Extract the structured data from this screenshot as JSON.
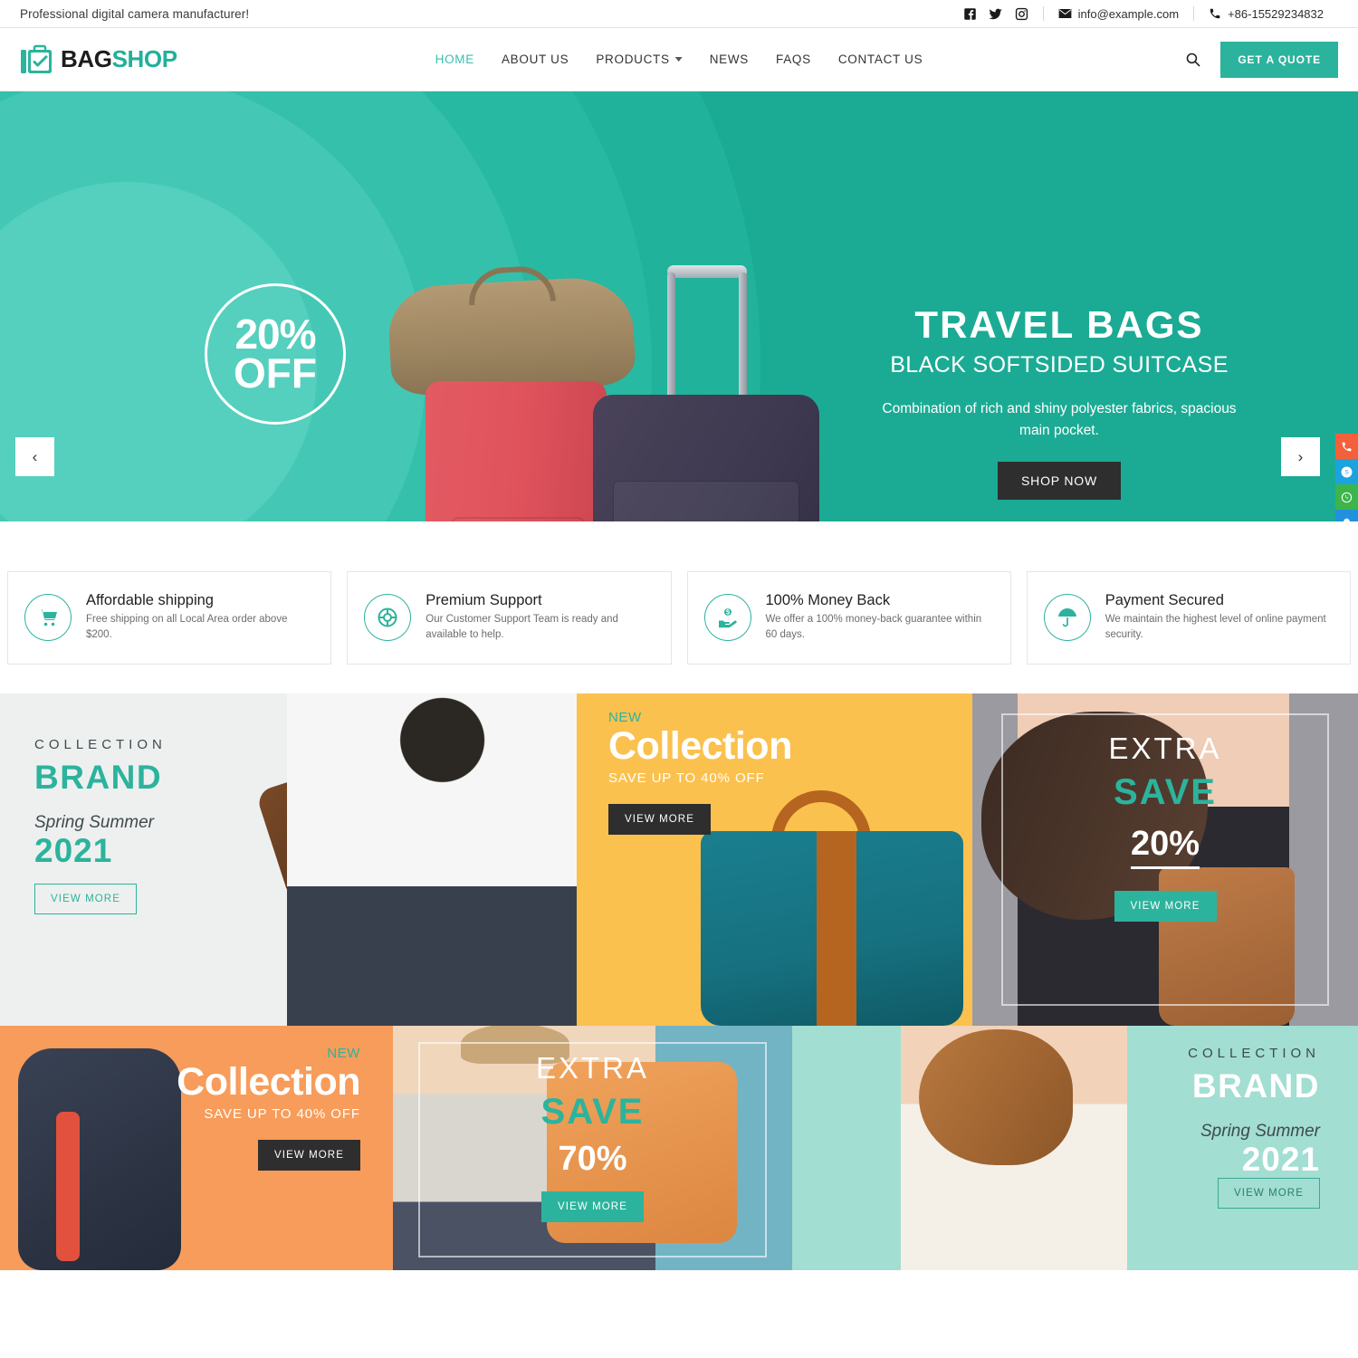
{
  "topbar": {
    "tagline": "Professional digital camera manufacturer!",
    "social": [
      {
        "name": "facebook-icon",
        "label": "Facebook"
      },
      {
        "name": "twitter-icon",
        "label": "Twitter"
      },
      {
        "name": "instagram-icon",
        "label": "Instagram"
      }
    ],
    "email": "info@example.com",
    "phone": "+86-15529234832"
  },
  "header": {
    "logo": {
      "part1": "BAG",
      "part2": "SHOP"
    },
    "nav": [
      {
        "label": "HOME",
        "active": true,
        "dropdown": false
      },
      {
        "label": "ABOUT US",
        "active": false,
        "dropdown": false
      },
      {
        "label": "PRODUCTS",
        "active": false,
        "dropdown": true
      },
      {
        "label": "NEWS",
        "active": false,
        "dropdown": false
      },
      {
        "label": "FAQS",
        "active": false,
        "dropdown": false
      },
      {
        "label": "CONTACT US",
        "active": false,
        "dropdown": false
      }
    ],
    "search_label": "Search",
    "quote_button": "GET A QUOTE"
  },
  "hero": {
    "badge_line1": "20%",
    "badge_line2": "OFF",
    "title": "TRAVEL BAGS",
    "subtitle": "BLACK SOFTSIDED SUITCASE",
    "description": "Combination of rich and shiny polyester fabrics, spacious main pocket.",
    "cta": "SHOP NOW",
    "prev_arrow": "‹",
    "next_arrow": "›",
    "background_color": "#1bab94"
  },
  "contact_rail": [
    {
      "name": "phone-icon",
      "color": "#f2603c"
    },
    {
      "name": "skype-icon",
      "color": "#1ba3e0"
    },
    {
      "name": "whatsapp-icon",
      "color": "#3cb54a"
    },
    {
      "name": "qq-icon",
      "color": "#2291dd"
    },
    {
      "name": "wechat-icon",
      "color": "#3cb54a"
    },
    {
      "name": "email-icon",
      "color": "#b13bd4"
    }
  ],
  "features": [
    {
      "icon": "shopping-cart-icon",
      "title": "Affordable shipping",
      "desc": "Free shipping on all Local Area order above $200."
    },
    {
      "icon": "lifebuoy-icon",
      "title": "Premium Support",
      "desc": "Our Customer Support Team is ready and available to help."
    },
    {
      "icon": "hand-money-icon",
      "title": "100% Money Back",
      "desc": "We offer a 100% money-back guarantee within 60 days."
    },
    {
      "icon": "umbrella-icon",
      "title": "Payment Secured",
      "desc": "We maintain the highest level of online payment security."
    }
  ],
  "promos": {
    "brand_light": {
      "kicker": "COLLECTION",
      "title": "BRAND",
      "season": "Spring Summer",
      "year": "2021",
      "button": "VIEW MORE"
    },
    "yellow": {
      "kicker": "NEW",
      "title": "Collection",
      "subtitle": "SAVE UP TO 40% OFF",
      "button": "VIEW MORE"
    },
    "grey": {
      "line1": "EXTRA",
      "line2": "SAVE",
      "line3": "20%",
      "button": "VIEW MORE"
    },
    "orange": {
      "kicker": "NEW",
      "title": "Collection",
      "subtitle": "SAVE UP TO 40% OFF",
      "button": "VIEW MORE"
    },
    "blue": {
      "line1": "EXTRA",
      "line2": "SAVE",
      "line3": "70%",
      "button": "VIEW MORE"
    },
    "mint": {
      "kicker": "COLLECTION",
      "title": "BRAND",
      "season": "Spring Summer",
      "year": "2021",
      "button": "VIEW MORE"
    }
  },
  "colors": {
    "teal": "#2cb39d",
    "hero_teal": "#1bab94",
    "dark": "#2e2e2e",
    "yellow": "#fbc14e",
    "orange": "#f79c5a",
    "blue": "#72b4c4",
    "mint": "#a2ded1",
    "grey": "#9a9aa0"
  }
}
